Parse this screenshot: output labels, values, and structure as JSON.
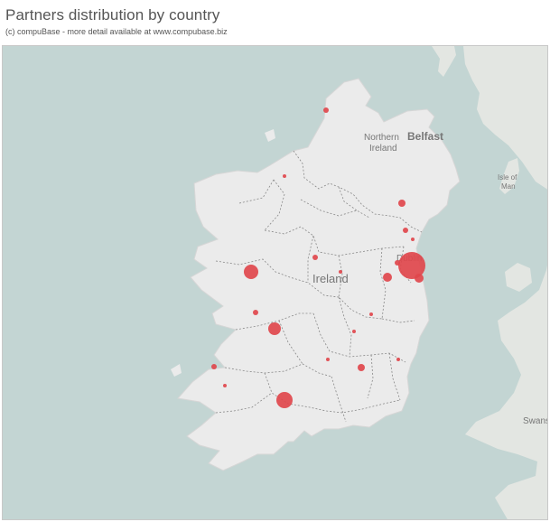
{
  "title": "Partners distribution by country",
  "subtitle": "(c) compuBase - more detail available at www.compubase.biz",
  "map": {
    "colors": {
      "sea": "#c3d5d3",
      "land": "#ebebeb",
      "britain": "#e3e6e2",
      "border": "#888888",
      "marker": "#e0474c"
    },
    "labels": {
      "northern_ireland_line1": "Northern",
      "northern_ireland_line2": "Ireland",
      "belfast": "Belfast",
      "ireland": "Ireland",
      "dublin": "Dublin",
      "isle_of_man_line1": "Isle of",
      "isle_of_man_line2": "Man",
      "swansea": "Swans"
    }
  }
}
